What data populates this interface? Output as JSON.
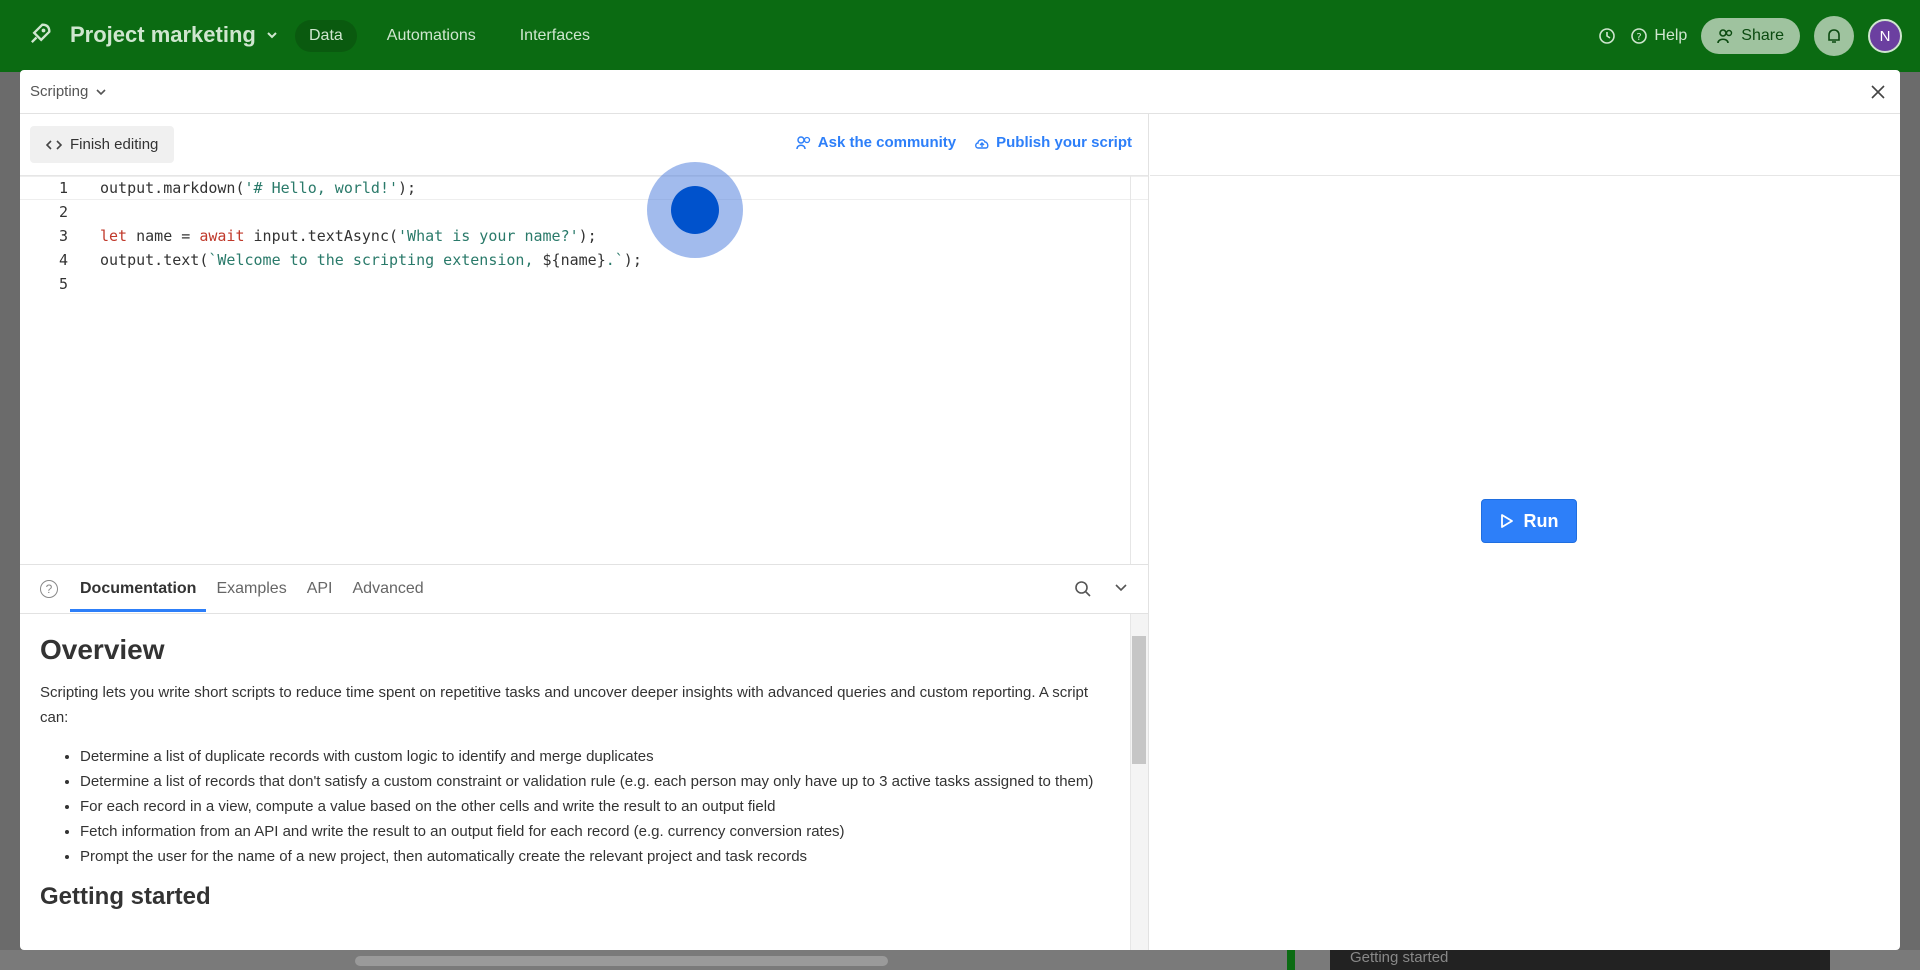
{
  "topbar": {
    "project_name": "Project marketing",
    "nav": [
      "Data",
      "Automations",
      "Interfaces"
    ],
    "help_label": "Help",
    "share_label": "Share",
    "avatar_initial": "N"
  },
  "background": {
    "toast_text": "Getting started"
  },
  "modal": {
    "title": "Scripting",
    "finish_label": "Finish editing",
    "ask_label": "Ask the community",
    "publish_label": "Publish your script",
    "run_label": "Run"
  },
  "code": {
    "lines": [
      {
        "n": "1",
        "text": "output.markdown('# Hello, world!');"
      },
      {
        "n": "2",
        "text": ""
      },
      {
        "n": "3",
        "text": "let name = await input.textAsync('What is your name?');"
      },
      {
        "n": "4",
        "text": "output.text(`Welcome to the scripting extension, ${name}.`);"
      },
      {
        "n": "5",
        "text": ""
      }
    ]
  },
  "docs": {
    "tabs": [
      "Documentation",
      "Examples",
      "API",
      "Advanced"
    ],
    "heading": "Overview",
    "intro": "Scripting lets you write short scripts to reduce time spent on repetitive tasks and uncover deeper insights with advanced queries and custom reporting. A script can:",
    "bullets": [
      "Determine a list of duplicate records with custom logic to identify and merge duplicates",
      "Determine a list of records that don't satisfy a custom constraint or validation rule (e.g. each person may only have up to 3 active tasks assigned to them)",
      "For each record in a view, compute a value based on the other cells and write the result to an output field",
      "Fetch information from an API and write the result to an output field for each record (e.g. currency conversion rates)",
      "Prompt the user for the name of a new project, then automatically create the relevant project and task records"
    ],
    "subheading": "Getting started"
  },
  "colors": {
    "topbar": "#0b6b12",
    "accent": "#2d7ff9"
  }
}
